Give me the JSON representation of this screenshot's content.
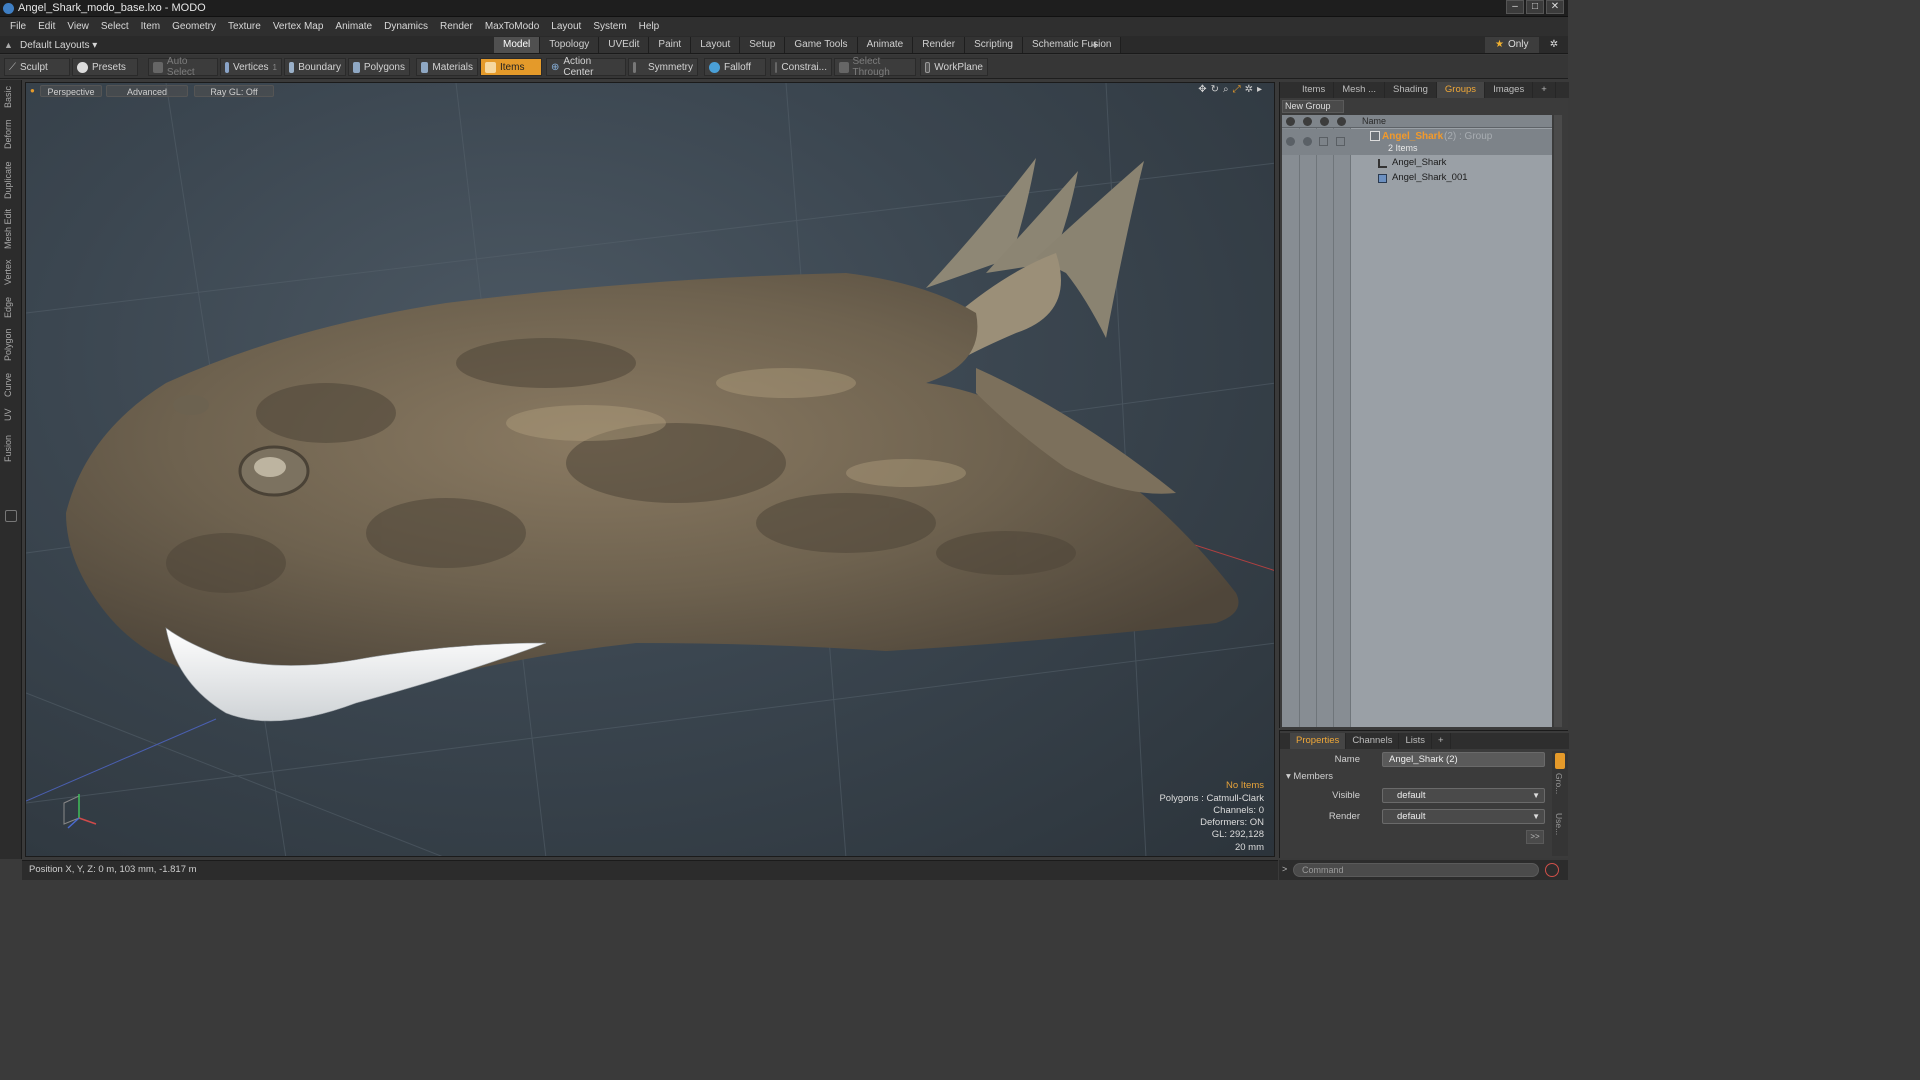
{
  "window": {
    "title": "Angel_Shark_modo_base.lxo - MODO"
  },
  "menu": [
    "File",
    "Edit",
    "View",
    "Select",
    "Item",
    "Geometry",
    "Texture",
    "Vertex Map",
    "Animate",
    "Dynamics",
    "Render",
    "MaxToModo",
    "Layout",
    "System",
    "Help"
  ],
  "layout_dropdown": "Default Layouts ▾",
  "layout_tabs": [
    "Model",
    "Topology",
    "UVEdit",
    "Paint",
    "Layout",
    "Setup",
    "Game Tools",
    "Animate",
    "Render",
    "Scripting",
    "Schematic Fusion"
  ],
  "layout_plus": "+",
  "only_label": "Only",
  "toolbar": {
    "sculpt": "Sculpt",
    "presets": "Presets",
    "auto_select": "Auto Select",
    "vertices": "Vertices",
    "vertices_count": "1",
    "boundary": "Boundary",
    "polygons": "Polygons",
    "materials": "Materials",
    "items": "Items",
    "action_center": "Action Center",
    "symmetry": "Symmetry",
    "falloff": "Falloff",
    "constraints": "Constrai...",
    "select_through": "Select Through",
    "workplane": "WorkPlane"
  },
  "left_tabs": [
    "Basic",
    "Deform",
    "Duplicate",
    "Mesh Edit",
    "Vertex",
    "Edge",
    "Polygon",
    "Curve",
    "UV",
    "Fusion"
  ],
  "viewport": {
    "view": "Perspective",
    "shading": "Advanced",
    "raygl": "Ray GL: Off",
    "info": {
      "warning": "No Items",
      "polygons": "Polygons : Catmull-Clark",
      "channels": "Channels: 0",
      "deformers": "Deformers: ON",
      "gl": "GL: 292,128",
      "scale": "20 mm"
    }
  },
  "status": "Position X, Y, Z:  0 m, 103 mm, -1.817 m",
  "groups_panel": {
    "tabs": [
      "Items",
      "Mesh ...",
      "Shading",
      "Groups",
      "Images"
    ],
    "active_tab": "Groups",
    "new_group": "New Group",
    "name_header": "Name",
    "group": {
      "name": "Angel_Shark",
      "suffix": "(2) : Group",
      "count": "2 Items"
    },
    "items": [
      "Angel_Shark",
      "Angel_Shark_001"
    ]
  },
  "properties_panel": {
    "tabs": [
      "Properties",
      "Channels",
      "Lists"
    ],
    "name_label": "Name",
    "name_value": "Angel_Shark (2)",
    "members": "Members",
    "visible_label": "Visible",
    "visible_value": "default",
    "render_label": "Render",
    "render_value": "default",
    "side_tabs": [
      "Gro...",
      "Use..."
    ]
  },
  "command": {
    "placeholder": "Command"
  },
  "colors": {
    "accent": "#e49a2a",
    "group_name": "#f39a2a",
    "viewport_bg": "#3b4650"
  }
}
